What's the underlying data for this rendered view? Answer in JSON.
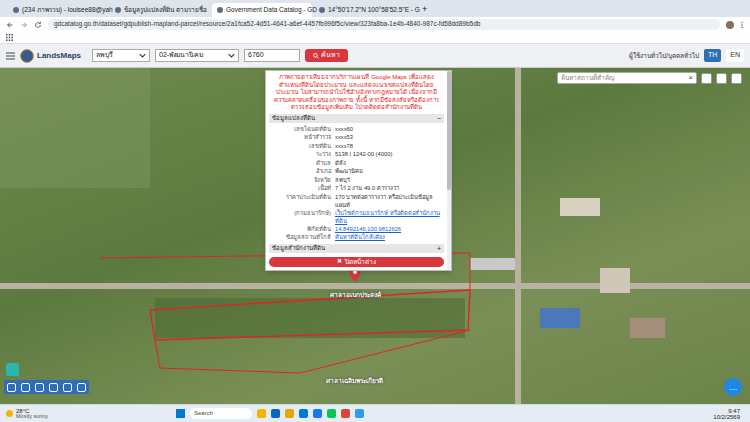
{
  "browser": {
    "tabs": [
      {
        "label": "(234 ภาพรวม) - louisee88@yah",
        "selected": false
      },
      {
        "label": "ข้อมูลรูปแปลงที่ดิน ตามรายชื่อ",
        "selected": false
      },
      {
        "label": "Government Data Catalog - GD",
        "selected": true
      },
      {
        "label": "14°50'17.2\"N 100°58'52.5\"E - G",
        "selected": false
      }
    ],
    "new_tab": "+",
    "url": "gdcatalog.go.th/dataset/gdpublish-mapland-parcel/resource/2a1fca52-4d51-4641-a6ef-4457fb996f5c/view/323fa8ba-1e4b-4840-987c-fd58dd89b5db"
  },
  "header": {
    "logo": "LandsMaps",
    "province": "ลพบุรี",
    "district": "02-พัฒนานิคม",
    "parcel_no": "6760",
    "search_button": "ค้นหา",
    "user": "ผู้ใช้งานทั่วไป/บุคคลทั่วไป",
    "languages": [
      {
        "label": "TH",
        "selected": true
      },
      {
        "label": "EN",
        "selected": false
      }
    ]
  },
  "map": {
    "search_placeholder": "ค้นหาสถานที่สำคัญ",
    "clear": "×",
    "labels": [
      "ศาลาอเนกประสงค์",
      "ศาลาเฉลิมพระเกียรติ"
    ],
    "chat": "…"
  },
  "popup": {
    "warning": "ภาพถ่ายดาวเทียมจากบริการแผนที่ Google Maps เพื่อแสดงตำแหน่งที่ดินโดยประมาณ และแสดงแนวเขตแปลงที่ดินโดยประมาณ ไม่สามารถนำไปใช้อ้างอิงทางกฎหมายได้ เนื่องจากมีความคลาดเคลื่อนของภาพถ่าย ทั้งนี้ หากมีข้อสงสัยหรือต้องการตรวจสอบข้อมูลเพิ่มเติม โปรดติดต่อสำนักงานที่ดิน",
    "section_title": "ข้อมูลแปลงที่ดิน",
    "section_toggle": "−",
    "rows": [
      {
        "label": "เลขโฉนดที่ดิน",
        "value": "xxxx60",
        "kind": "text"
      },
      {
        "label": "หน้าสำรวจ",
        "value": "xxxx53",
        "kind": "text"
      },
      {
        "label": "เลขที่ดิน",
        "value": "xxxx78",
        "kind": "text"
      },
      {
        "label": "ระวาง",
        "value": "5138 I 1242-00 (4000)",
        "kind": "text"
      },
      {
        "label": "ตำบล",
        "value": "ดีลัง",
        "kind": "text"
      },
      {
        "label": "อำเภอ",
        "value": "พัฒนานิคม",
        "kind": "text"
      },
      {
        "label": "จังหวัด",
        "value": "ลพบุรี",
        "kind": "text"
      },
      {
        "label": "เนื้อที่",
        "value": "7 ไร่ 2 งาน 49.0 ตารางวา",
        "kind": "text"
      },
      {
        "label": "ราคาประเมินที่ดิน",
        "value": "170 บาทต่อตารางวา หรือประเมินข้อมูลแผนที่",
        "kind": "text"
      },
      {
        "label": "(กรมธนารักษ์)",
        "value": "เว็บไซต์กรมธนารักษ์ หรือติดต่อสำนักงานที่ดิน",
        "kind": "link"
      },
      {
        "label": "พิกัดที่ดิน",
        "value": "14.8492146,100.9812626",
        "kind": "link"
      },
      {
        "label": "ข้อมูลสถานที่ใกล้",
        "value": "ค้นหาที่ดินใกล้เคียง",
        "kind": "link"
      }
    ],
    "office_title": "ข้อมูลสำนักงานที่ดิน",
    "office_toggle": "+",
    "close_icon": "✖",
    "close_label": "ปิดหน้าต่าง"
  },
  "taskbar": {
    "temperature": "28°C",
    "condition": "Mostly sunny",
    "search": "Search",
    "time": "9:47",
    "date": "10/2/2569"
  }
}
